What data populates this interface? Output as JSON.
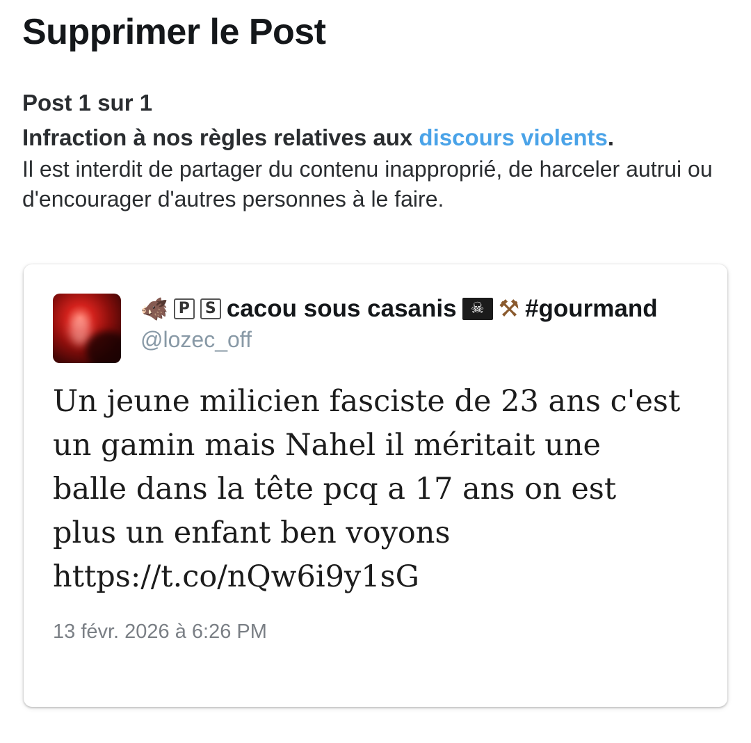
{
  "page": {
    "title": "Supprimer le Post"
  },
  "report": {
    "counter": "Post 1 sur 1",
    "violation_prefix": "Infraction à nos règles relatives aux ",
    "policy_link": "discours violents",
    "violation_suffix": ".",
    "explanation": "Il est interdit de partager du contenu inapproprié, de harceler autrui ou d'encourager d'autres personnes à le faire.",
    "link_color": "#4aa3e8"
  },
  "tweet": {
    "author": {
      "name_icons": [
        "boar-icon",
        "boxed-letter-p",
        "boxed-letter-s"
      ],
      "boxed_letters": [
        "P",
        "S"
      ],
      "name": "cacou sous casanis",
      "name_trailing_icons": [
        "pirate-flag-icon",
        "hammer-and-pick-icon"
      ],
      "name_suffix": "#gourmand",
      "handle": "@lozec_off"
    },
    "text_lines": [
      "Un jeune milicien fasciste de 23 ans c'est",
      "un gamin mais Nahel il méritait une",
      "balle dans la tête pcq a 17 ans on est",
      "plus un enfant ben voyons",
      "https://t.co/nQw6i9y1sG"
    ],
    "timestamp": "13 févr. 2026 à 6:26 PM"
  }
}
